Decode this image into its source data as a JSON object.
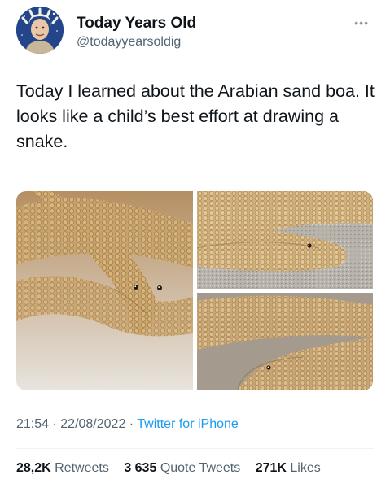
{
  "author": {
    "display_name": "Today Years Old",
    "handle": "@todayyearsoldig",
    "more_icon": "ellipsis-icon"
  },
  "tweet": {
    "text": "Today I learned about the Arabian sand boa. It looks like a child’s best effort at drawing a snake."
  },
  "media": {
    "count": 3,
    "photos": [
      "sand-boa-photo-1",
      "sand-boa-photo-2",
      "sand-boa-photo-3"
    ]
  },
  "meta": {
    "time": "21:54",
    "sep1": " · ",
    "date": "22/08/2022",
    "sep2": " · ",
    "source": "Twitter for iPhone"
  },
  "stats": {
    "retweets_count": "28,2K",
    "retweets_label": "Retweets",
    "quotes_count": "3 635",
    "quotes_label": "Quote Tweets",
    "likes_count": "271K",
    "likes_label": "Likes"
  },
  "colors": {
    "link": "#1d9bf0",
    "secondary_text": "#536471",
    "primary_text": "#0f1419"
  }
}
